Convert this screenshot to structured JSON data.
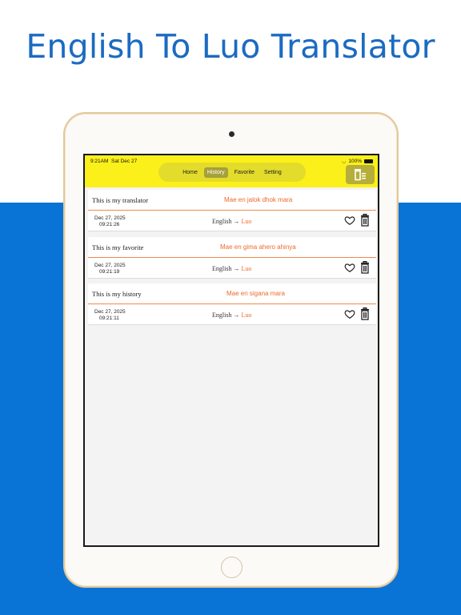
{
  "headline": "English To Luo Translator",
  "status": {
    "time": "9:21AM",
    "date": "Sat Dec 27",
    "battery": "100%"
  },
  "tabs": [
    {
      "label": "Home",
      "active": false
    },
    {
      "label": "History",
      "active": true
    },
    {
      "label": "Favorite",
      "active": false
    },
    {
      "label": "Setting",
      "active": false
    }
  ],
  "toolbar": {
    "clear_icon": "trash-list-icon"
  },
  "entries": [
    {
      "source": "This is my translator",
      "translation": "Mae en jalok dhok mara",
      "date": "Dec 27, 2025",
      "time": "09:21:26",
      "from": "English →",
      "to": "Luo"
    },
    {
      "source": "This is my favorite",
      "translation": "Mae en gima ahero ahinya",
      "date": "Dec 27, 2025",
      "time": "09:21:19",
      "from": "English →",
      "to": "Luo"
    },
    {
      "source": "This is my history",
      "translation": "Mae en sigana mara",
      "date": "Dec 27, 2025",
      "time": "09:21:11",
      "from": "English →",
      "to": "Luo"
    }
  ],
  "colors": {
    "accent_yellow": "#fcf01a",
    "brand_blue": "#0a73d6",
    "translation_orange": "#ee6a2a",
    "headline_blue": "#1b6bc1"
  }
}
